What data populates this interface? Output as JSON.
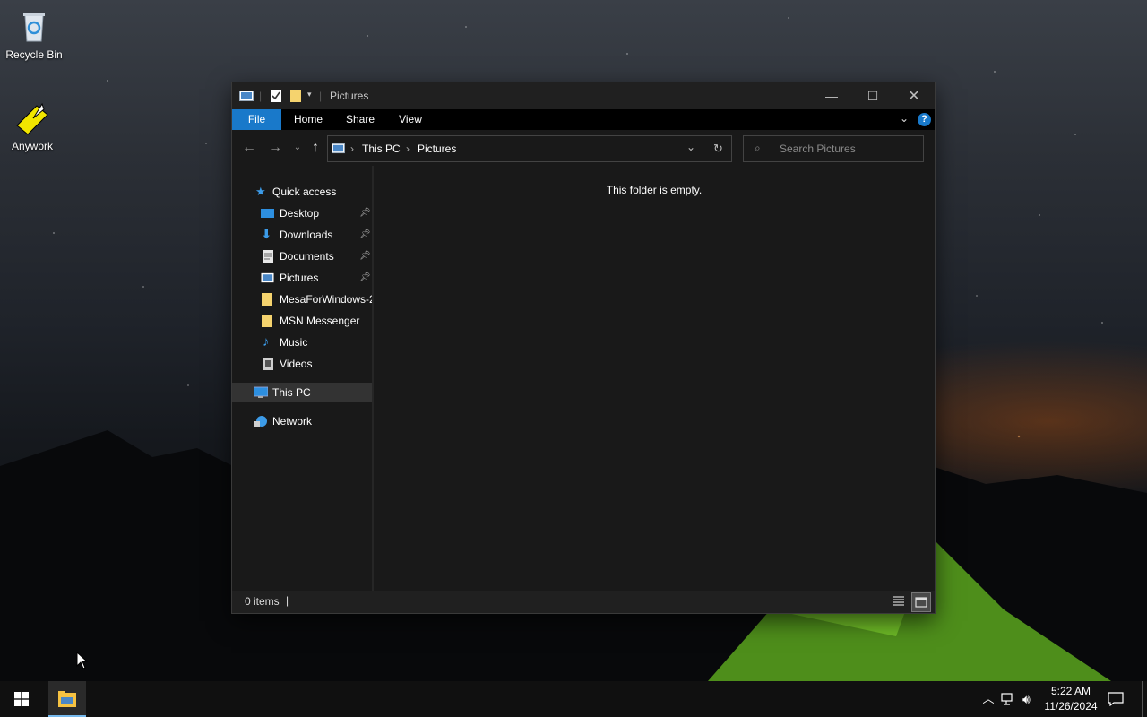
{
  "desktop": {
    "icons": [
      {
        "label": "Recycle Bin"
      },
      {
        "label": "Anywork"
      }
    ]
  },
  "window": {
    "title": "Pictures",
    "ribbon_tabs": {
      "file": "File",
      "home": "Home",
      "share": "Share",
      "view": "View"
    },
    "breadcrumb": {
      "root": "This PC",
      "current": "Pictures"
    },
    "search_placeholder": "Search Pictures",
    "nav": {
      "quick_access": "Quick access",
      "desktop": "Desktop",
      "downloads": "Downloads",
      "documents": "Documents",
      "pictures": "Pictures",
      "mesa": "MesaForWindows-2",
      "msn": "MSN Messenger",
      "music": "Music",
      "videos": "Videos",
      "this_pc": "This PC",
      "network": "Network"
    },
    "empty_message": "This folder is empty.",
    "status": {
      "item_count": "0 items"
    }
  },
  "taskbar": {
    "time": "5:22 AM",
    "date": "11/26/2024"
  },
  "colors": {
    "accent": "#1979ca",
    "window_bg": "#191919",
    "selected_nav": "#333333"
  }
}
